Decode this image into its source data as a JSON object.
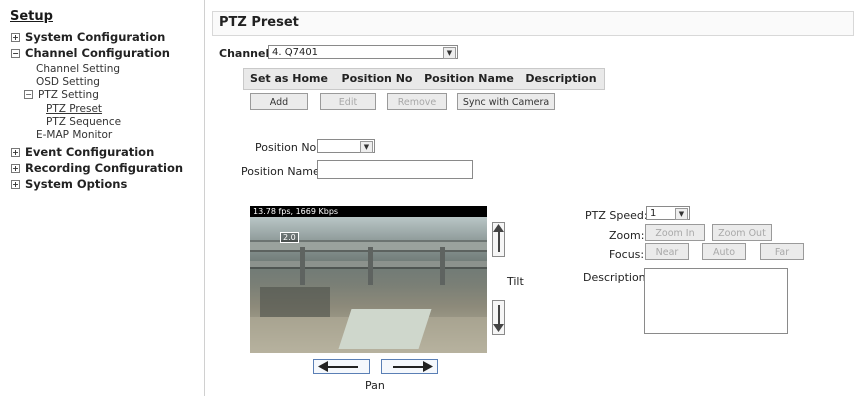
{
  "sidebar": {
    "title": "Setup",
    "system_configuration": "System Configuration",
    "channel_configuration": "Channel Configuration",
    "channel_setting": "Channel Setting",
    "osd_setting": "OSD Setting",
    "ptz_setting": "PTZ Setting",
    "ptz_preset": "PTZ Preset",
    "ptz_sequence": "PTZ Sequence",
    "emap_monitor": "E-MAP Monitor",
    "event_configuration": "Event Configuration",
    "recording_configuration": "Recording Configuration",
    "system_options": "System Options"
  },
  "main": {
    "title": "PTZ Preset",
    "channel_label": "Channel:",
    "channel_value": "4. Q7401",
    "table_headers": [
      "Set as Home",
      "Position No",
      "Position Name",
      "Description"
    ],
    "buttons": {
      "add": "Add",
      "edit": "Edit",
      "remove": "Remove",
      "sync": "Sync with Camera"
    },
    "position_no_label": "Position No:",
    "position_name_label": "Position Name:",
    "video_status": "13.78 fps, 1669 Kbps",
    "zoom_badge": "2.0",
    "tilt_label": "Tilt",
    "pan_label": "Pan",
    "ptz_speed_label": "PTZ Speed:",
    "ptz_speed_value": "1",
    "zoom_label": "Zoom:",
    "zoom_in": "Zoom In",
    "zoom_out": "Zoom Out",
    "focus_label": "Focus:",
    "focus_near": "Near",
    "focus_auto": "Auto",
    "focus_far": "Far",
    "description_label": "Description:"
  }
}
